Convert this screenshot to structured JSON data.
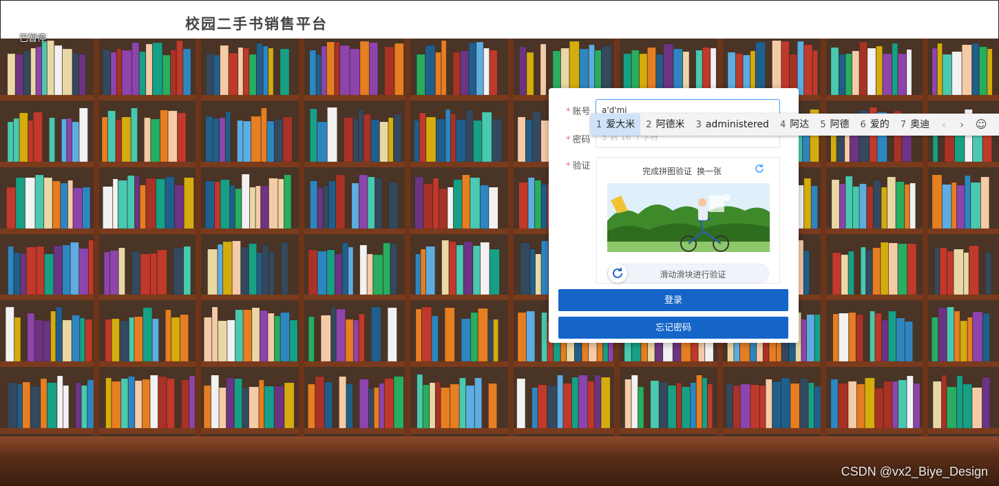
{
  "header": {
    "title": "校园二手书销售平台"
  },
  "overlay": {
    "paused_label": "已暂停"
  },
  "login": {
    "account_label": "账号",
    "account_value": "a'd'mi",
    "password_label": "密码",
    "password_placeholder": "5 到 16 个字符",
    "captcha_label": "验证",
    "captcha_title": "完成拼图验证",
    "captcha_switch": "换一张",
    "slider_text": "滑动滑块进行验证",
    "login_button": "登录",
    "forgot_button": "忘记密码"
  },
  "ime": {
    "candidates": [
      {
        "num": "1",
        "text": "爱大米"
      },
      {
        "num": "2",
        "text": "阿德米"
      },
      {
        "num": "3",
        "text": "administered"
      },
      {
        "num": "4",
        "text": "阿达"
      },
      {
        "num": "5",
        "text": "阿德"
      },
      {
        "num": "6",
        "text": "爱的"
      },
      {
        "num": "7",
        "text": "奥迪"
      }
    ],
    "prev_icon": "chevron-left-icon",
    "next_icon": "chevron-right-icon",
    "emoji_icon": "smiley-icon"
  },
  "watermark": "CSDN @vx2_Biye_Design",
  "colors": {
    "primary_button": "#1565c8",
    "required_mark": "#f56c6c",
    "focus_border": "#409eff",
    "ime_selected": "#cfe3f8"
  }
}
